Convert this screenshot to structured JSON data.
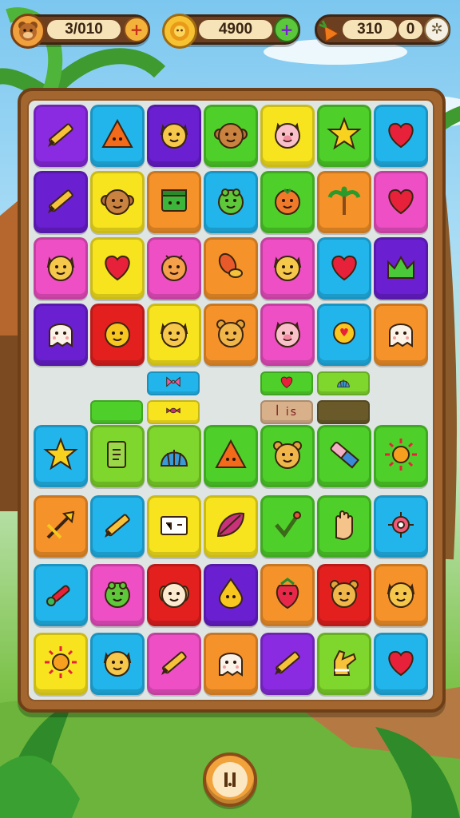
{
  "hud": {
    "coins": {
      "icon": "bear-face-icon",
      "value": "3/010",
      "button_icon": "plus-icon"
    },
    "score": {
      "icon": "lion-badge-icon",
      "value": "4900",
      "button_icon": "plus-icon"
    },
    "energy": {
      "icon": "carrot-icon",
      "value": "310",
      "secondary_value": "0",
      "button_icon": "gear-icon"
    }
  },
  "colors": {
    "purple": "#8a2be2",
    "blue": "#22b5ec",
    "green": "#4fcf2a",
    "lime": "#7fd62c",
    "yellow": "#f7e41f",
    "orange": "#f5922a",
    "pink": "#ee4fc4",
    "red": "#e4201f",
    "violet": "#6a1fd0"
  },
  "board": {
    "rows": [
      [
        {
          "color": "purple",
          "icon": "pencil-icon"
        },
        {
          "color": "blue",
          "icon": "triangle-icon"
        },
        {
          "color": "violet",
          "icon": "cat-face-icon"
        },
        {
          "color": "green",
          "icon": "monkey-icon"
        },
        {
          "color": "yellow",
          "icon": "pig-face-icon"
        },
        {
          "color": "green",
          "icon": "star-icon"
        },
        {
          "color": "blue",
          "icon": "heart-icon"
        }
      ],
      [
        {
          "color": "violet",
          "icon": "pencil-icon"
        },
        {
          "color": "yellow",
          "icon": "monkey-icon"
        },
        {
          "color": "orange",
          "icon": "box-icon"
        },
        {
          "color": "blue",
          "icon": "frog-face-icon"
        },
        {
          "color": "green",
          "icon": "tomato-icon"
        },
        {
          "color": "orange",
          "icon": "palm-tree-icon"
        },
        {
          "color": "pink",
          "icon": "heart-icon"
        }
      ],
      [
        {
          "color": "pink",
          "icon": "cat-face-icon"
        },
        {
          "color": "yellow",
          "icon": "heart-icon"
        },
        {
          "color": "pink",
          "icon": "bug-icon"
        },
        {
          "color": "orange",
          "icon": "bean-icon"
        },
        {
          "color": "pink",
          "icon": "cat-face-icon"
        },
        {
          "color": "blue",
          "icon": "heart-icon"
        },
        {
          "color": "violet",
          "icon": "crown-icon"
        }
      ],
      [
        {
          "color": "violet",
          "icon": "ghost-icon"
        },
        {
          "color": "red",
          "icon": "smiley-face-icon"
        },
        {
          "color": "yellow",
          "icon": "cat-face-icon"
        },
        {
          "color": "orange",
          "icon": "bear-face-icon"
        },
        {
          "color": "pink",
          "icon": "pig-face-icon"
        },
        {
          "color": "blue",
          "icon": "bird-icon"
        },
        {
          "color": "orange",
          "icon": "ghost-icon"
        }
      ]
    ],
    "mid_blocks": [
      {
        "color": "blue",
        "icon": "bow-icon",
        "text": ""
      },
      {
        "color": "green",
        "icon": "heart-icon",
        "text": ""
      },
      {
        "color": "lime",
        "icon": "shell-icon",
        "text": ""
      },
      {
        "color": "green",
        "icon": "",
        "text": ""
      },
      {
        "color": "yellow",
        "icon": "candy-icon",
        "text": ""
      },
      {
        "color": "tan",
        "icon": "",
        "text": "ꟾ is"
      },
      {
        "color": "dark",
        "icon": "",
        "text": ""
      }
    ],
    "lower_rows": [
      [
        {
          "color": "blue",
          "icon": "star-icon"
        },
        {
          "color": "lime",
          "icon": "scroll-icon"
        },
        {
          "color": "lime",
          "icon": "shell-icon"
        },
        {
          "color": "green",
          "icon": "triangle-icon"
        },
        {
          "color": "green",
          "icon": "bear-face-icon"
        },
        {
          "color": "green",
          "icon": "eraser-icon"
        },
        {
          "color": "green",
          "icon": "sun-icon"
        }
      ],
      [
        {
          "color": "orange",
          "icon": "arrow-icon"
        },
        {
          "color": "blue",
          "icon": "pencil-icon"
        },
        {
          "color": "yellow",
          "icon": "note-icon"
        },
        {
          "color": "yellow",
          "icon": "leaf-icon"
        },
        {
          "color": "green",
          "icon": "check-icon"
        },
        {
          "color": "green",
          "icon": "hand-icon"
        },
        {
          "color": "blue",
          "icon": "target-icon"
        }
      ],
      [
        {
          "color": "blue",
          "icon": "bone-icon"
        },
        {
          "color": "pink",
          "icon": "frog-face-icon"
        },
        {
          "color": "red",
          "icon": "dog-face-icon"
        },
        {
          "color": "violet",
          "icon": "drop-icon"
        },
        {
          "color": "orange",
          "icon": "strawberry-icon"
        },
        {
          "color": "red",
          "icon": "bear-face-icon"
        },
        {
          "color": "orange",
          "icon": "cat-face-icon"
        }
      ],
      [
        {
          "color": "yellow",
          "icon": "sun-icon"
        },
        {
          "color": "blue",
          "icon": "cat-face-icon"
        },
        {
          "color": "pink",
          "icon": "pencil-icon"
        },
        {
          "color": "orange",
          "icon": "ghost-icon"
        },
        {
          "color": "purple",
          "icon": "pencil-icon"
        },
        {
          "color": "lime",
          "icon": "glove-icon"
        },
        {
          "color": "blue",
          "icon": "heart-icon"
        }
      ]
    ]
  },
  "bottom_button": {
    "icon": "pause-icon"
  }
}
